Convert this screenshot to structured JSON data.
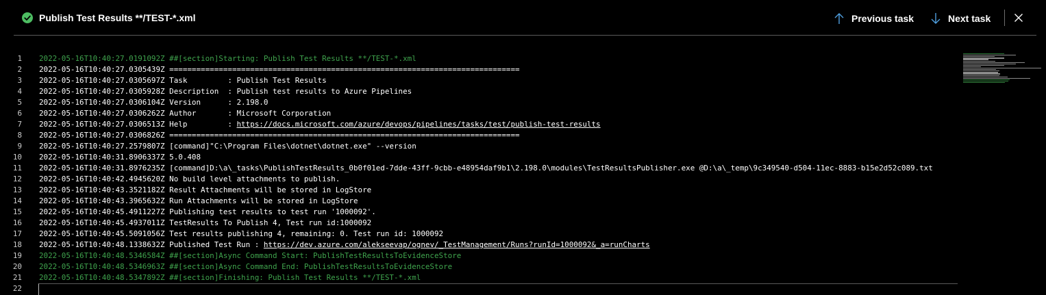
{
  "header": {
    "title": "Publish Test Results **/TEST-*.xml",
    "status_icon": "success-check-icon",
    "status_color": "#4dbd62",
    "prev_label": "Previous task",
    "next_label": "Next task"
  },
  "colors": {
    "background": "#000000",
    "section_text": "#3fa34d",
    "normal_text": "#ffffff",
    "line_number": "#cccccc"
  },
  "log": [
    {
      "n": "1",
      "text": "2022-05-16T10:40:27.0191092Z ##[section]Starting: Publish Test Results **/TEST-*.xml",
      "style": "green"
    },
    {
      "n": "2",
      "text": "2022-05-16T10:40:27.0305439Z ==============================================================================",
      "style": "normal"
    },
    {
      "n": "3",
      "text": "2022-05-16T10:40:27.0305697Z Task         : Publish Test Results",
      "style": "normal"
    },
    {
      "n": "4",
      "text": "2022-05-16T10:40:27.0305928Z Description  : Publish test results to Azure Pipelines",
      "style": "normal"
    },
    {
      "n": "5",
      "text": "2022-05-16T10:40:27.0306104Z Version      : 2.198.0",
      "style": "normal"
    },
    {
      "n": "6",
      "text": "2022-05-16T10:40:27.0306262Z Author       : Microsoft Corporation",
      "style": "normal"
    },
    {
      "n": "7",
      "text": "2022-05-16T10:40:27.0306513Z Help         : ",
      "link": "https://docs.microsoft.com/azure/devops/pipelines/tasks/test/publish-test-results",
      "style": "normal"
    },
    {
      "n": "8",
      "text": "2022-05-16T10:40:27.0306826Z ==============================================================================",
      "style": "normal"
    },
    {
      "n": "9",
      "text": "2022-05-16T10:40:27.2579807Z [command]\"C:\\Program Files\\dotnet\\dotnet.exe\" --version",
      "style": "normal"
    },
    {
      "n": "10",
      "text": "2022-05-16T10:40:31.8906337Z 5.0.408",
      "style": "normal"
    },
    {
      "n": "11",
      "text": "2022-05-16T10:40:31.8976235Z [command]D:\\a\\_tasks\\PublishTestResults_0b0f01ed-7dde-43ff-9cbb-e48954daf9b1\\2.198.0\\modules\\TestResultsPublisher.exe @D:\\a\\_temp\\9c349540-d504-11ec-8883-b15e2d52c089.txt",
      "style": "normal"
    },
    {
      "n": "12",
      "text": "2022-05-16T10:40:42.4945620Z No build level attachments to publish.",
      "style": "normal"
    },
    {
      "n": "13",
      "text": "2022-05-16T10:40:43.3521182Z Result Attachments will be stored in LogStore",
      "style": "normal"
    },
    {
      "n": "14",
      "text": "2022-05-16T10:40:43.3965632Z Run Attachments will be stored in LogStore",
      "style": "normal"
    },
    {
      "n": "15",
      "text": "2022-05-16T10:40:45.4911227Z Publishing test results to test run '1000092'.",
      "style": "normal"
    },
    {
      "n": "16",
      "text": "2022-05-16T10:40:45.4937011Z TestResults To Publish 4, Test run id:1000092",
      "style": "normal"
    },
    {
      "n": "17",
      "text": "2022-05-16T10:40:45.5091056Z Test results publishing 4, remaining: 0. Test run id: 1000092",
      "style": "normal"
    },
    {
      "n": "18",
      "text": "2022-05-16T10:40:48.1338632Z Published Test Run : ",
      "link": "https://dev.azure.com/alekseevap/ognev/_TestManagement/Runs?runId=1000092&_a=runCharts",
      "style": "normal"
    },
    {
      "n": "19",
      "text": "2022-05-16T10:40:48.5346584Z ##[section]Async Command Start: PublishTestResultsToEvidenceStore",
      "style": "green"
    },
    {
      "n": "20",
      "text": "2022-05-16T10:40:48.5346963Z ##[section]Async Command End: PublishTestResultsToEvidenceStore",
      "style": "green"
    },
    {
      "n": "21",
      "text": "2022-05-16T10:40:48.5347892Z ##[section]Finishing: Publish Test Results **/TEST-*.xml",
      "style": "green"
    },
    {
      "n": "22",
      "text": "",
      "style": "normal"
    }
  ]
}
